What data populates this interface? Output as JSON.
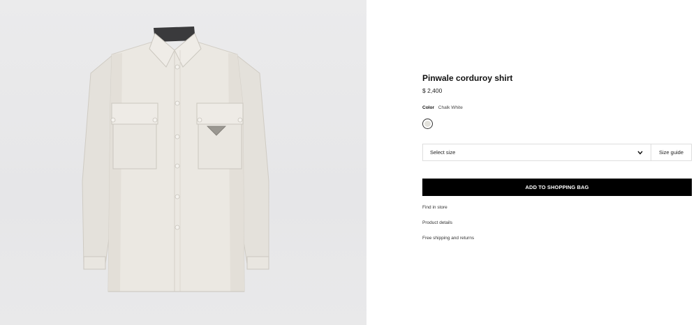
{
  "product": {
    "name": "Pinwale corduroy shirt",
    "price": "$ 2,400",
    "color_label": "Color",
    "color_value": "Chalk White",
    "swatch_color": "#e3e2dc",
    "image_icon": "shirt-image"
  },
  "size": {
    "select_label": "Select size",
    "guide_label": "Size guide"
  },
  "actions": {
    "add_to_bag": "ADD TO SHOPPING BAG"
  },
  "links": {
    "find_in_store": "Find in store",
    "product_details": "Product details",
    "shipping_returns": "Free shipping and returns"
  },
  "colors": {
    "background_panel": "#e8e8e9",
    "button": "#000000",
    "button_text": "#ffffff",
    "border": "#dedede"
  }
}
